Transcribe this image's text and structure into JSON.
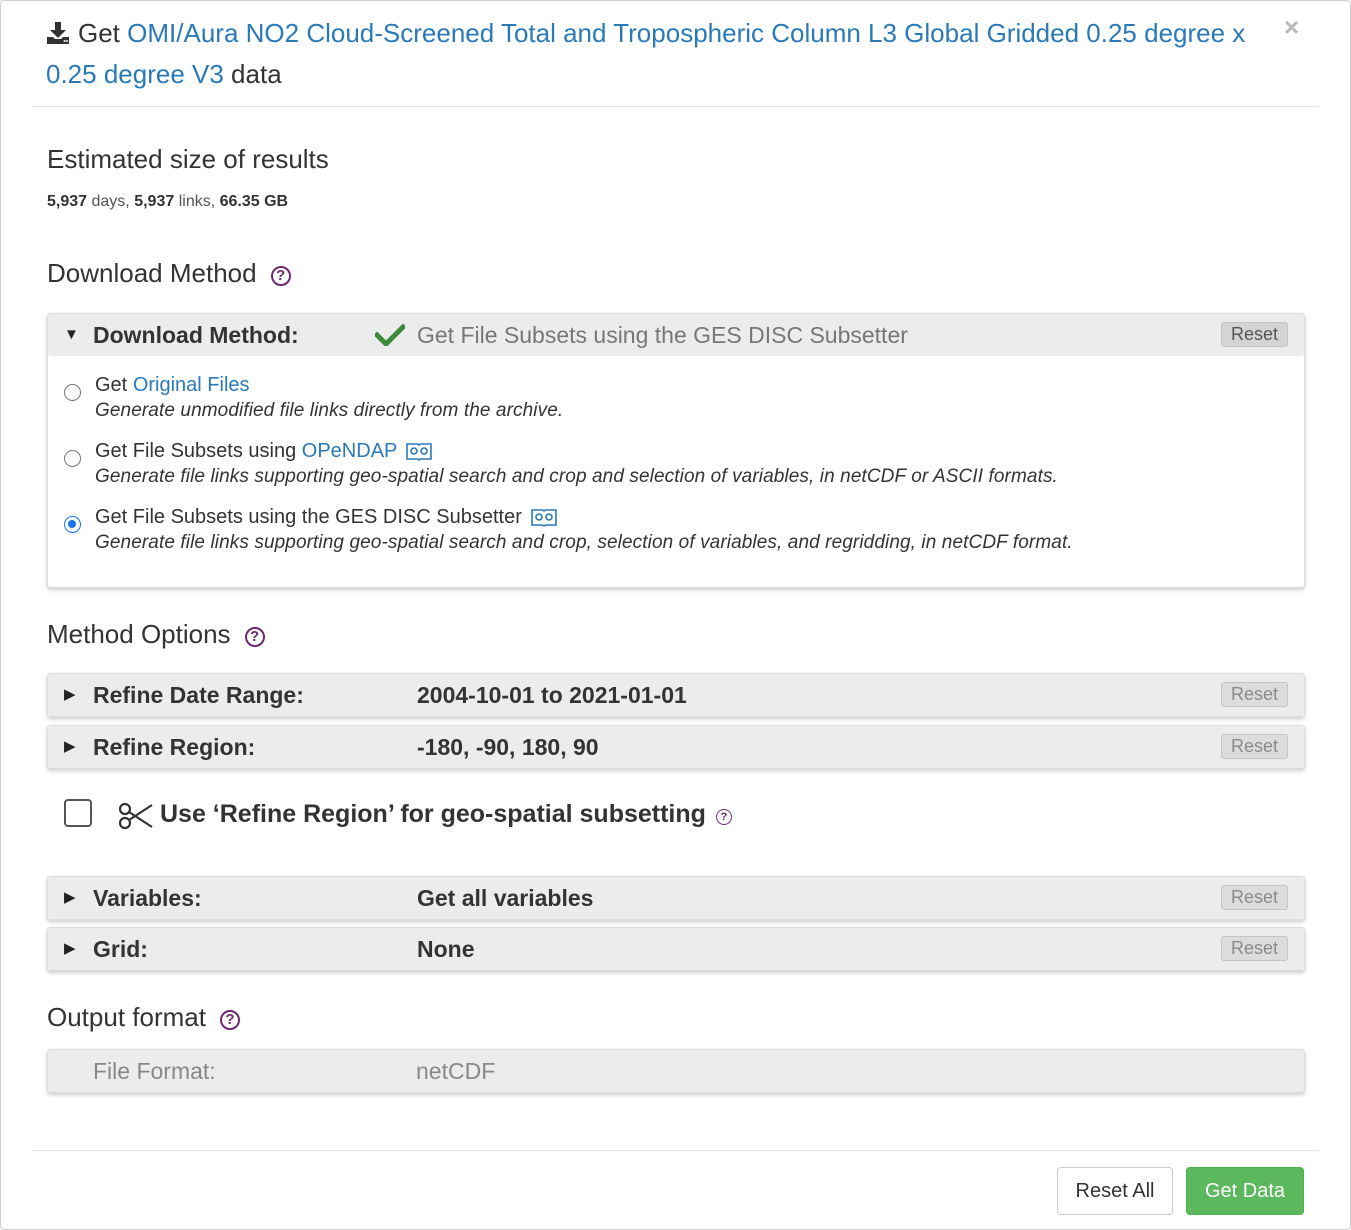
{
  "header": {
    "prefix": "Get",
    "dataset_link": "OMI/Aura NO2 Cloud-Screened Total and Tropospheric Column L3 Global Gridded 0.25 degree x 0.25 degree V3",
    "suffix": "data",
    "close": "×"
  },
  "estimate": {
    "heading": "Estimated size of results",
    "days": "5,937",
    "days_label": "days,",
    "links": "5,937",
    "links_label": "links,",
    "size": "66.35 GB"
  },
  "download_method": {
    "heading": "Download Method",
    "panel_label": "Download Method:",
    "selected_value": "Get File Subsets using the GES DISC Subsetter",
    "reset": "Reset",
    "options": [
      {
        "prefix": "Get",
        "link": "Original Files",
        "desc": "Generate unmodified file links directly from the archive.",
        "selected": false
      },
      {
        "prefix": "Get File Subsets using",
        "link": "OPeNDAP",
        "desc": "Generate file links supporting geo-spatial search and crop and selection of variables, in netCDF or ASCII formats.",
        "selected": false
      },
      {
        "prefix": "Get File Subsets using the GES DISC Subsetter",
        "link": "",
        "desc": "Generate file links supporting geo-spatial search and crop, selection of variables, and regridding, in netCDF format.",
        "selected": true
      }
    ]
  },
  "method_options": {
    "heading": "Method Options",
    "date_range": {
      "label": "Refine Date Range:",
      "value": "2004-10-01 to 2021-01-01",
      "reset": "Reset"
    },
    "region": {
      "label": "Refine Region:",
      "value": "-180, -90, 180, 90",
      "reset": "Reset"
    },
    "use_region": {
      "label": "Use ‘Refine Region’ for geo-spatial subsetting",
      "checked": false
    },
    "variables": {
      "label": "Variables:",
      "value": "Get all variables",
      "reset": "Reset"
    },
    "grid": {
      "label": "Grid:",
      "value": "None",
      "reset": "Reset"
    }
  },
  "output": {
    "heading": "Output format",
    "label": "File Format:",
    "value": "netCDF"
  },
  "footer": {
    "reset_all": "Reset All",
    "get_data": "Get Data"
  },
  "colors": {
    "link": "#2a7ab8",
    "primary_button": "#5cb85c",
    "help_icon": "#6e2a70",
    "check": "#3c8a3c"
  },
  "icons": [
    "download-icon",
    "close-icon",
    "help-icon",
    "caret-down-icon",
    "caret-right-icon",
    "checkmark-icon",
    "book-icon",
    "scissors-icon"
  ]
}
